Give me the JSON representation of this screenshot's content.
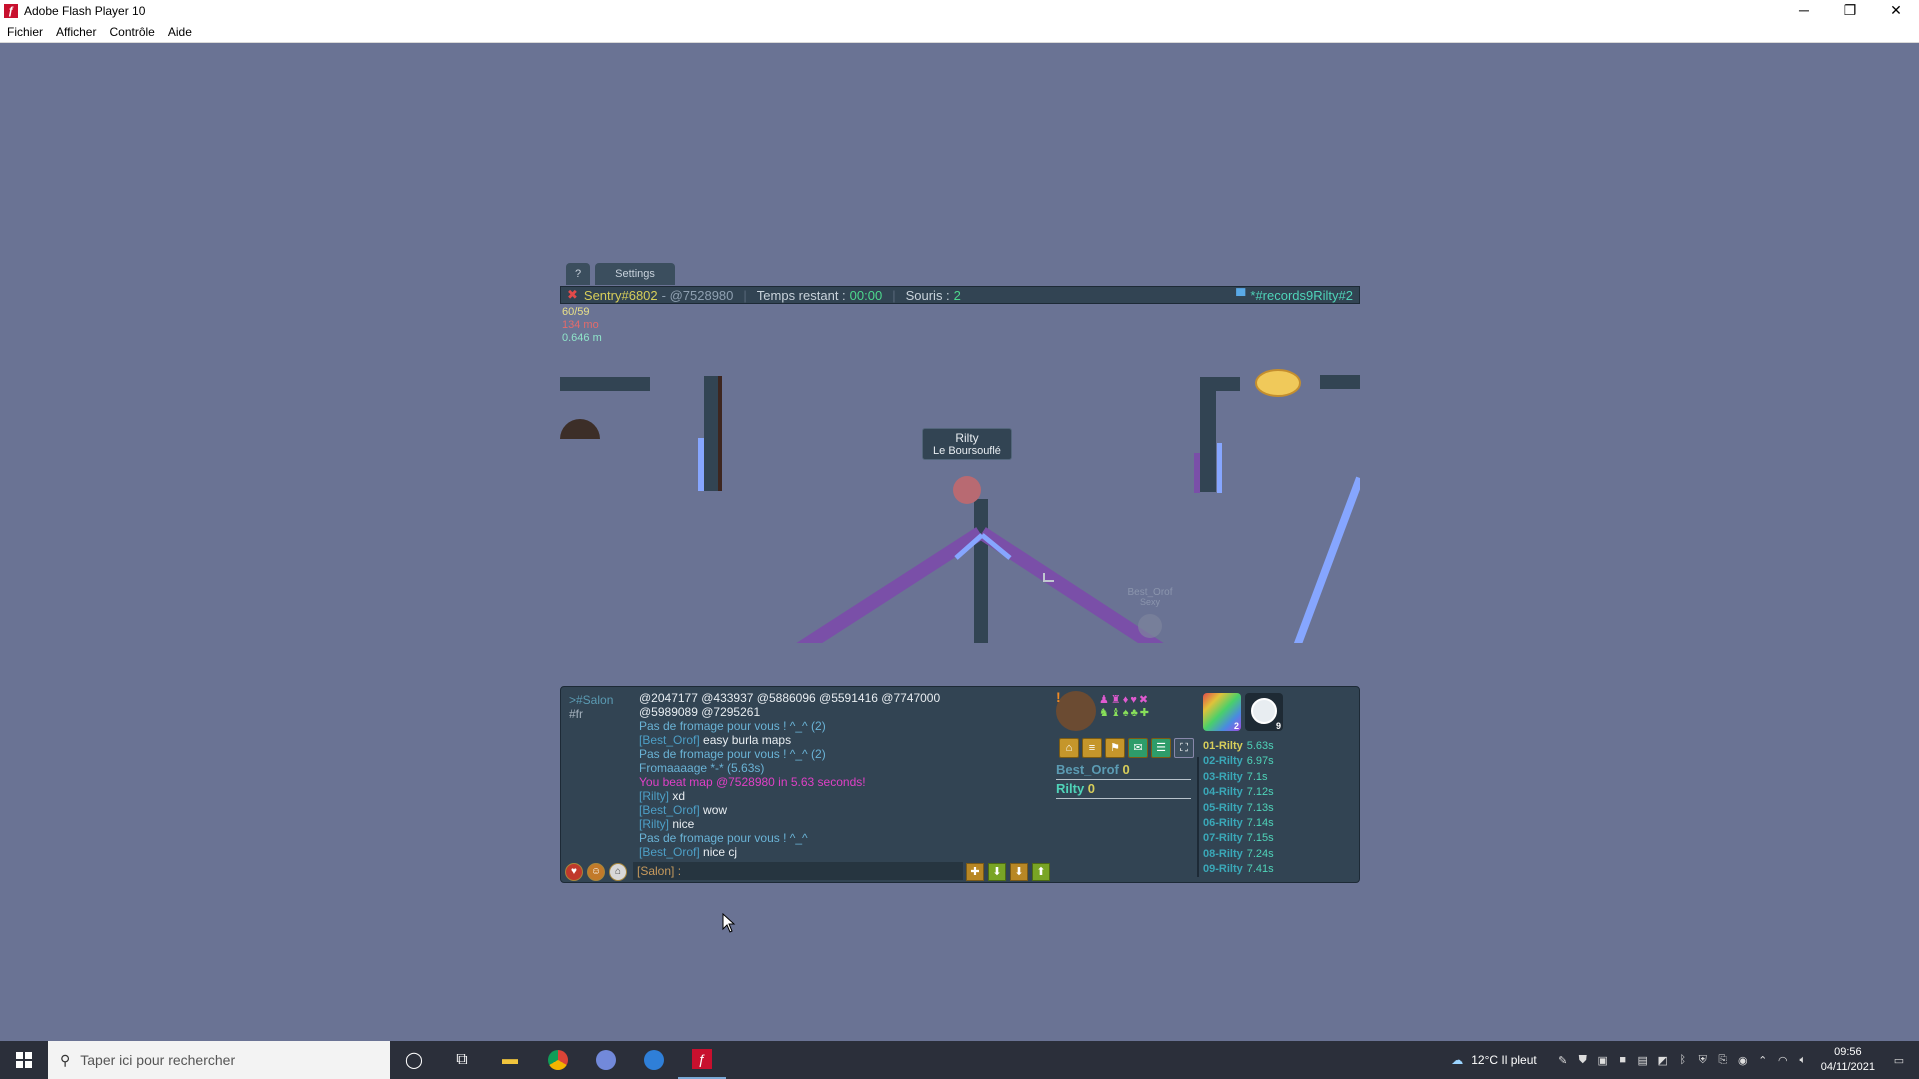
{
  "window": {
    "title": "Adobe Flash Player 10",
    "menu": [
      "Fichier",
      "Afficher",
      "Contrôle",
      "Aide"
    ]
  },
  "game": {
    "tabs": [
      "?",
      "Settings"
    ],
    "hud": {
      "player": "Sentry#6802",
      "map_code": "- @7528980",
      "time_label": "Temps restant :",
      "time_value": "00:00",
      "mice_label": "Souris :",
      "mice_value": "2",
      "room": "*#records9Rilty#2"
    },
    "stats": {
      "fps": "60/59",
      "memory": "134 mo",
      "distance": "0.646 m"
    },
    "nametag": {
      "name": "Rilty",
      "title": "Le Boursouflé"
    },
    "ghost": {
      "name": "Best_Orof",
      "title": "Sexy"
    },
    "channels": {
      "active": ">#Salon",
      "other": "#fr"
    },
    "chat": [
      {
        "type": "white",
        "text": "@2047177 @433937 @5886096 @5591416 @7747000"
      },
      {
        "type": "white",
        "text": "@5989089 @7295261"
      },
      {
        "type": "sys",
        "text": "Pas de fromage pour vous ! ^_^ (2)"
      },
      {
        "type": "msg",
        "name": "[Best_Orof]",
        "text": " easy burla maps"
      },
      {
        "type": "sys",
        "text": "Pas de fromage pour vous ! ^_^ (2)"
      },
      {
        "type": "sys",
        "text": "Fromaaaage *-* (5.63s)"
      },
      {
        "type": "pink",
        "text": "You beat map @7528980 in 5.63 seconds!"
      },
      {
        "type": "msg",
        "name": "[Rilty]",
        "text": " xd"
      },
      {
        "type": "msg",
        "name": "[Best_Orof]",
        "text": " wow"
      },
      {
        "type": "msg",
        "name": "[Rilty]",
        "text": " nice"
      },
      {
        "type": "sys",
        "text": "Pas de fromage pour vous ! ^_^"
      },
      {
        "type": "msg",
        "name": "[Best_Orof]",
        "text": " nice cj"
      }
    ],
    "chat_input": "[Salon] :",
    "scores": [
      {
        "name": "Best_Orof",
        "score": "0"
      },
      {
        "name": "Rilty",
        "score": "0"
      }
    ],
    "ranking": [
      {
        "rank": "01-Rilty",
        "time": "5.63s"
      },
      {
        "rank": "02-Rilty",
        "time": "6.97s"
      },
      {
        "rank": "03-Rilty",
        "time": "7.1s"
      },
      {
        "rank": "04-Rilty",
        "time": "7.12s"
      },
      {
        "rank": "05-Rilty",
        "time": "7.13s"
      },
      {
        "rank": "06-Rilty",
        "time": "7.14s"
      },
      {
        "rank": "07-Rilty",
        "time": "7.15s"
      },
      {
        "rank": "08-Rilty",
        "time": "7.24s"
      },
      {
        "rank": "09-Rilty",
        "time": "7.41s"
      }
    ],
    "medal_counts": [
      "2",
      "9"
    ]
  },
  "taskbar": {
    "search_placeholder": "Taper ici pour rechercher",
    "weather": "12°C  Il pleut",
    "time": "09:56",
    "date": "04/11/2021"
  }
}
